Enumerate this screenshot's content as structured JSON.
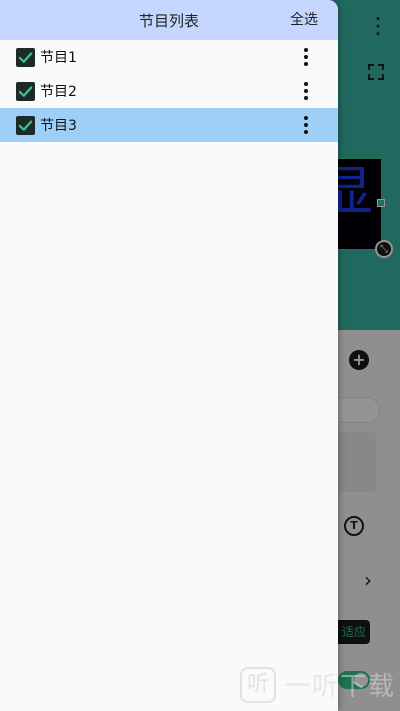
{
  "drawer": {
    "title": "节目列表",
    "select_all_label": "全选",
    "items": [
      {
        "label": "节目1",
        "checked": true,
        "selected": false
      },
      {
        "label": "节目2",
        "checked": true,
        "selected": false
      },
      {
        "label": "节目3",
        "checked": true,
        "selected": true
      }
    ]
  },
  "background": {
    "preview_glyph": "显",
    "adapt_label": "适应"
  },
  "watermark": {
    "text": "一听下载"
  },
  "colors": {
    "header_bg": "#c6d7ff",
    "selected_row_bg": "#9ecff6",
    "checkbox_bg": "#1d2a29",
    "check_color": "#34c48a",
    "accent": "#34c48a"
  },
  "icons": {
    "checkbox": "check-icon",
    "row_menu": "more-vert-icon",
    "fullscreen": "fullscreen-icon",
    "add": "add-circle-icon",
    "text": "text-format-icon",
    "chevron": "chevron-right-icon"
  }
}
